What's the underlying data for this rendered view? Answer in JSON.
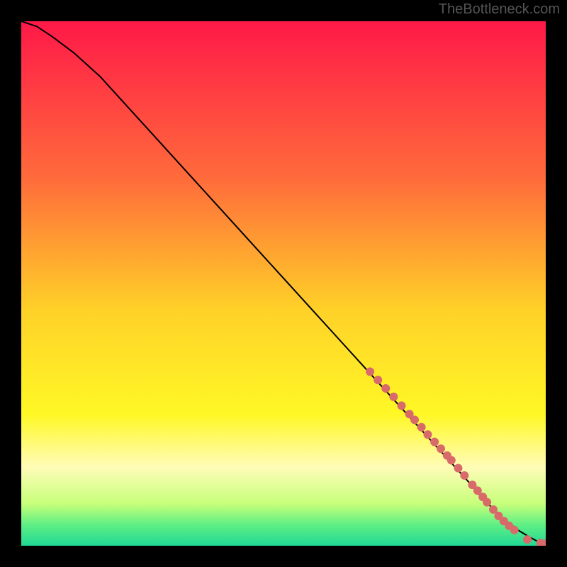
{
  "watermark": "TheBottleneck.com",
  "chart_data": {
    "type": "line",
    "title": "",
    "xlabel": "",
    "ylabel": "",
    "xlim": [
      0,
      100
    ],
    "ylim": [
      0,
      100
    ],
    "background_gradient": {
      "stops": [
        {
          "offset": 0.0,
          "color": "#ff1948"
        },
        {
          "offset": 0.3,
          "color": "#ff6b3b"
        },
        {
          "offset": 0.55,
          "color": "#ffd128"
        },
        {
          "offset": 0.75,
          "color": "#fff826"
        },
        {
          "offset": 0.85,
          "color": "#fffcb8"
        },
        {
          "offset": 0.92,
          "color": "#c7ff7a"
        },
        {
          "offset": 0.96,
          "color": "#5fef84"
        },
        {
          "offset": 1.0,
          "color": "#20d895"
        }
      ]
    },
    "series": [
      {
        "name": "curve",
        "x": [
          0,
          3,
          6,
          10,
          15,
          20,
          25,
          30,
          35,
          40,
          45,
          50,
          55,
          60,
          65,
          70,
          75,
          80,
          85,
          88,
          91,
          93,
          95,
          97,
          98.5,
          100
        ],
        "y": [
          100,
          99,
          97,
          94,
          89.5,
          84,
          78.5,
          73,
          67.5,
          62,
          56.5,
          51,
          45.5,
          40,
          34.5,
          29,
          23.5,
          18,
          12.5,
          9,
          6,
          4.3,
          2.8,
          1.6,
          0.8,
          0.4
        ],
        "color": "#000000",
        "linewidth": 2
      }
    ],
    "scatter_points": {
      "color": "#d96a6a",
      "radius": 6,
      "points": [
        {
          "x": 66.5,
          "y": 33.2
        },
        {
          "x": 68.0,
          "y": 31.6
        },
        {
          "x": 69.5,
          "y": 30.0
        },
        {
          "x": 71.0,
          "y": 28.4
        },
        {
          "x": 72.5,
          "y": 26.7
        },
        {
          "x": 74.0,
          "y": 25.1
        },
        {
          "x": 75.0,
          "y": 24.0
        },
        {
          "x": 76.3,
          "y": 22.6
        },
        {
          "x": 77.5,
          "y": 21.2
        },
        {
          "x": 78.8,
          "y": 19.8
        },
        {
          "x": 80.0,
          "y": 18.5
        },
        {
          "x": 81.2,
          "y": 17.2
        },
        {
          "x": 82.0,
          "y": 16.3
        },
        {
          "x": 83.3,
          "y": 14.8
        },
        {
          "x": 84.5,
          "y": 13.4
        },
        {
          "x": 86.0,
          "y": 11.6
        },
        {
          "x": 87.0,
          "y": 10.5
        },
        {
          "x": 88.0,
          "y": 9.3
        },
        {
          "x": 88.8,
          "y": 8.3
        },
        {
          "x": 90.0,
          "y": 6.9
        },
        {
          "x": 91.0,
          "y": 5.7
        },
        {
          "x": 92.0,
          "y": 4.7
        },
        {
          "x": 93.0,
          "y": 3.8
        },
        {
          "x": 94.0,
          "y": 3.0
        },
        {
          "x": 96.5,
          "y": 1.2
        },
        {
          "x": 99.0,
          "y": 0.5
        },
        {
          "x": 100.0,
          "y": 0.4
        }
      ]
    }
  }
}
